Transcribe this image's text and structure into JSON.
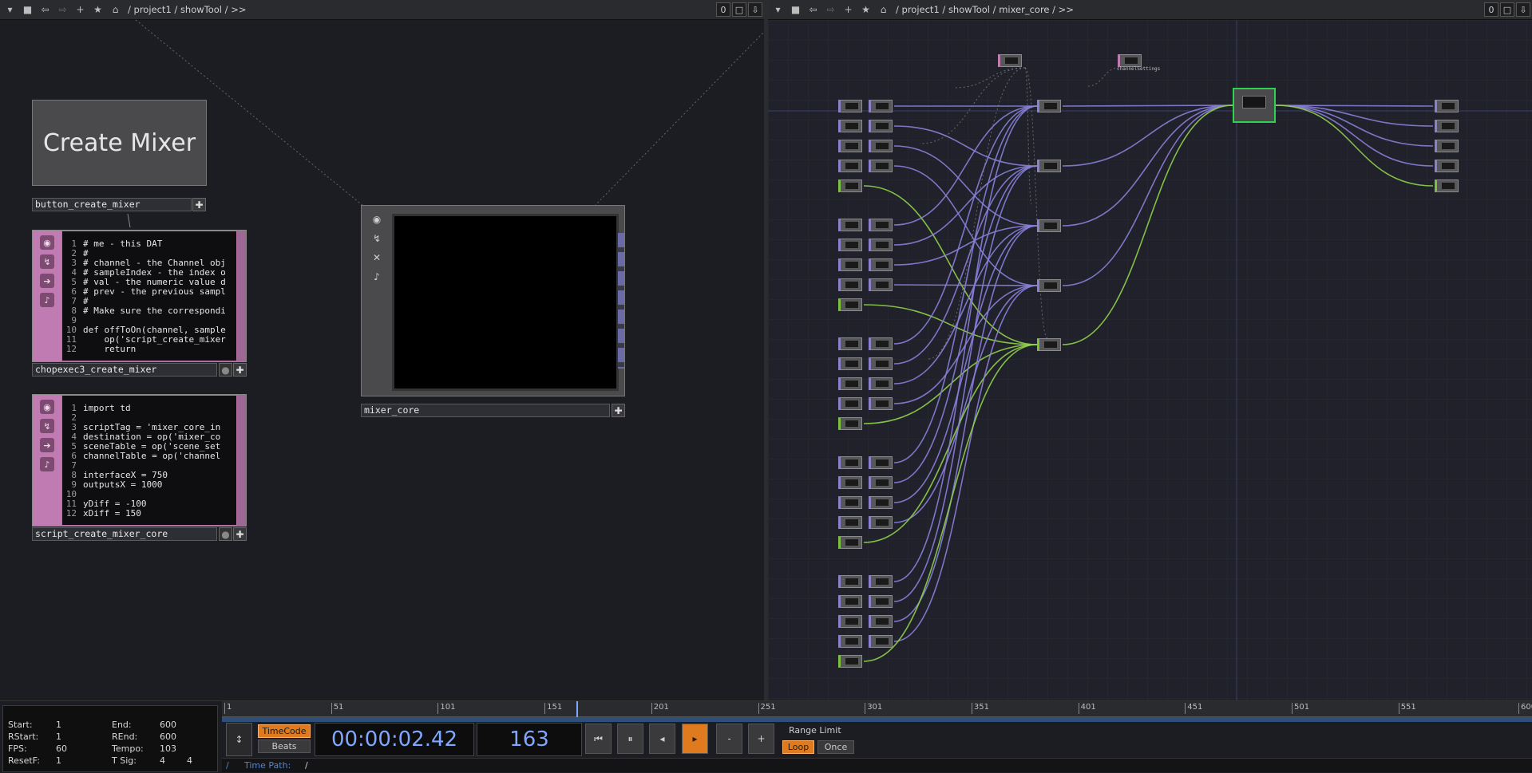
{
  "left_pane": {
    "path": "/ project1 / showTool / >>",
    "counter": "0",
    "button_node": {
      "label": "Create Mixer",
      "name": "button_create_mixer"
    },
    "chopexec": {
      "name": "chopexec3_create_mixer",
      "lines": [
        {
          "n": "1",
          "t": "# me - this DAT"
        },
        {
          "n": "2",
          "t": "#"
        },
        {
          "n": "3",
          "t": "# channel - the Channel obj"
        },
        {
          "n": "4",
          "t": "# sampleIndex - the index o"
        },
        {
          "n": "5",
          "t": "# val - the numeric value d"
        },
        {
          "n": "6",
          "t": "# prev - the previous sampl"
        },
        {
          "n": "7",
          "t": "#"
        },
        {
          "n": "8",
          "t": "# Make sure the correspondi"
        },
        {
          "n": "9",
          "t": ""
        },
        {
          "n": "10",
          "t": "def offToOn(channel, sample"
        },
        {
          "n": "11",
          "t": "    op('script_create_mixer"
        },
        {
          "n": "12",
          "t": "    return"
        }
      ]
    },
    "script": {
      "name": "script_create_mixer_core",
      "lines": [
        {
          "n": "1",
          "t": "import td"
        },
        {
          "n": "2",
          "t": ""
        },
        {
          "n": "3",
          "t": "scriptTag = 'mixer_core_in"
        },
        {
          "n": "4",
          "t": "destination = op('mixer_co"
        },
        {
          "n": "5",
          "t": "sceneTable = op('scene_set"
        },
        {
          "n": "6",
          "t": "channelTable = op('channel"
        },
        {
          "n": "7",
          "t": ""
        },
        {
          "n": "8",
          "t": "interfaceX = 750"
        },
        {
          "n": "9",
          "t": "outputsX = 1000"
        },
        {
          "n": "10",
          "t": ""
        },
        {
          "n": "11",
          "t": "yDiff = -100"
        },
        {
          "n": "12",
          "t": "xDiff = 150"
        }
      ]
    },
    "viewer": {
      "name": "mixer_core"
    }
  },
  "right_pane": {
    "path": "/ project1 / showTool / mixer_core / >>",
    "counter": "0",
    "note_label": "channelSettings"
  },
  "timeline": {
    "ruler": [
      "1",
      "51",
      "101",
      "151",
      "201",
      "251",
      "301",
      "351",
      "401",
      "451",
      "501",
      "551",
      "600"
    ],
    "stats": {
      "start_label": "Start:",
      "start": "1",
      "end_label": "End:",
      "end": "600",
      "rstart_label": "RStart:",
      "rstart": "1",
      "rend_label": "REnd:",
      "rend": "600",
      "fps_label": "FPS:",
      "fps": "60",
      "tempo_label": "Tempo:",
      "tempo": "103",
      "resetf_label": "ResetF:",
      "resetf": "1",
      "tsig_label": "T Sig:",
      "tsig_a": "4",
      "tsig_b": "4"
    },
    "timecode_label": "TimeCode",
    "beats_label": "Beats",
    "time_display": "00:00:02.42",
    "frame_display": "163",
    "range_limit_label": "Range Limit",
    "loop_label": "Loop",
    "once_label": "Once",
    "time_path_label": "Time Path:",
    "time_path_value": "/",
    "slash": "/"
  },
  "colors": {
    "accent": "#e07a1f",
    "purple_wire": "#8a80d8",
    "green_wire": "#8fd04a",
    "dat_pink": "#b371a6"
  }
}
